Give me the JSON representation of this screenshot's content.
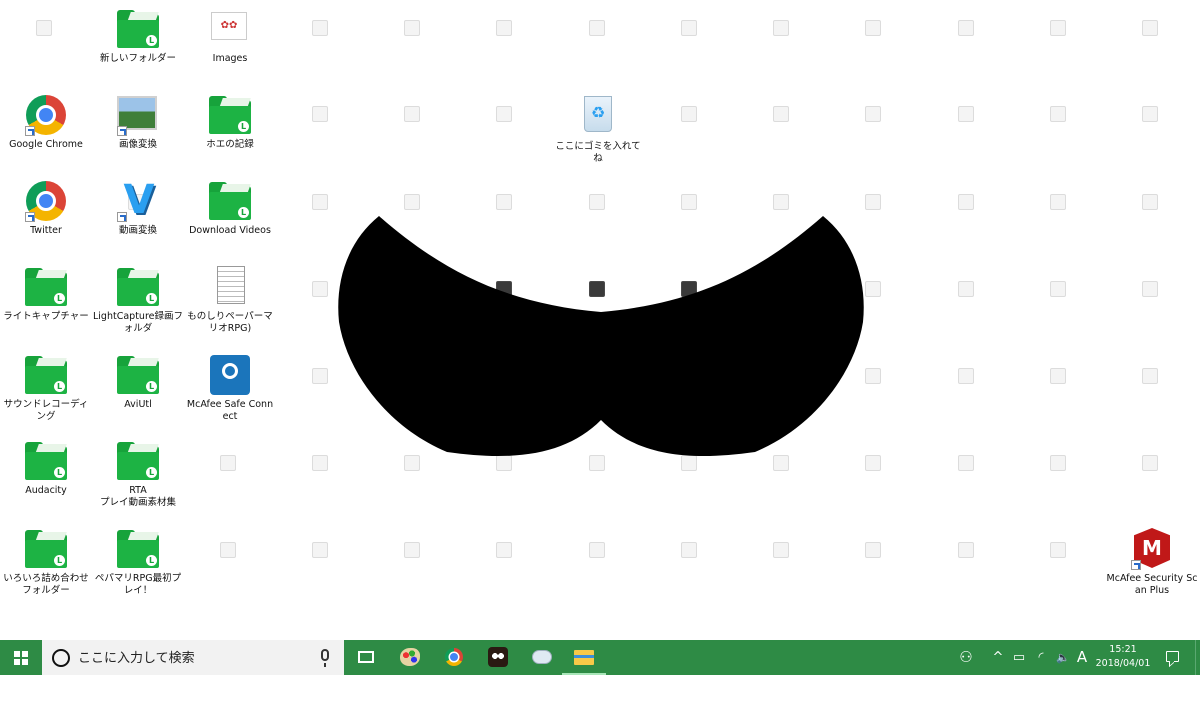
{
  "desktop": {
    "icons": [
      {
        "label": "新しいフォルダー",
        "kind": "folder",
        "col": 1,
        "row": 0
      },
      {
        "label": "Images",
        "kind": "images",
        "col": 2,
        "row": 0
      },
      {
        "label": "Google Chrome",
        "kind": "chrome",
        "col": 0,
        "row": 1,
        "shortcut": true
      },
      {
        "label": "画像変換",
        "kind": "photo",
        "col": 1,
        "row": 1,
        "shortcut": true
      },
      {
        "label": "ホエの記録",
        "kind": "folder",
        "col": 2,
        "row": 1
      },
      {
        "label": "Twitter",
        "kind": "chrome",
        "col": 0,
        "row": 2,
        "shortcut": true
      },
      {
        "label": "動画変換",
        "kind": "v-logo",
        "col": 1,
        "row": 2,
        "shortcut": true
      },
      {
        "label": "Download Videos",
        "kind": "folder",
        "col": 2,
        "row": 2
      },
      {
        "label": "ライトキャプチャー",
        "kind": "folder",
        "col": 0,
        "row": 3
      },
      {
        "label": "LightCapture録画フォルダ",
        "kind": "folder",
        "col": 1,
        "row": 3
      },
      {
        "label": "ものしりペーパーマリオRPG)",
        "kind": "document",
        "col": 2,
        "row": 3
      },
      {
        "label": "サウンドレコーディング",
        "kind": "folder",
        "col": 0,
        "row": 4
      },
      {
        "label": "AviUtl",
        "kind": "folder",
        "col": 1,
        "row": 4
      },
      {
        "label": "McAfee Safe Connect",
        "kind": "mcafee-safe",
        "col": 2,
        "row": 4
      },
      {
        "label": "Audacity",
        "kind": "folder",
        "col": 0,
        "row": 5
      },
      {
        "label": "RTA\nプレイ動画素材集",
        "kind": "folder",
        "col": 1,
        "row": 5
      },
      {
        "label": "いろいろ詰め合わせフォルダー",
        "kind": "folder",
        "col": 0,
        "row": 6
      },
      {
        "label": "ペパマリRPG最初プレイ！",
        "kind": "folder",
        "col": 1,
        "row": 6
      }
    ],
    "recycle_bin_label": "ここにゴミを入れてね",
    "mcafee_scan_label": "McAfee Security Scan Plus",
    "folder_badge": "L"
  },
  "taskbar": {
    "search_placeholder": "ここに入力して検索",
    "ime_mode": "A",
    "tray_people": "⚇",
    "tray_chevron": "^",
    "tray_battery": "▭",
    "tray_wifi": "◜",
    "tray_volume": "🔈×",
    "time": "15:21",
    "date": "2018/04/01",
    "accent_color": "#2e8b45"
  },
  "icons": {
    "start": "windows-logo-icon",
    "search": "cortana-circle-icon",
    "mic": "microphone-icon",
    "task_view": "task-view-icon"
  }
}
